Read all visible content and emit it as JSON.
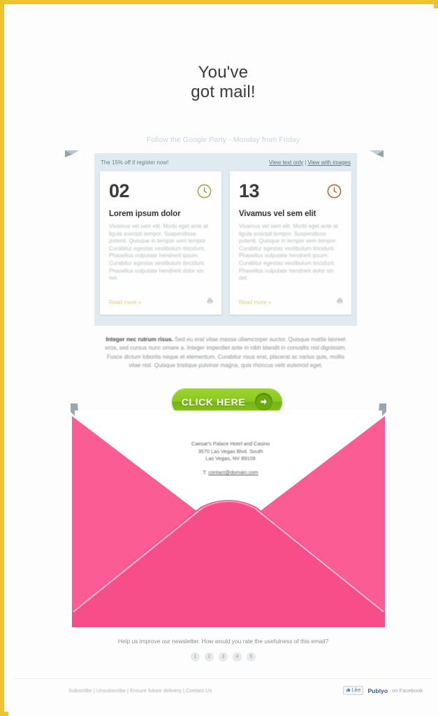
{
  "frame": {
    "border_color": "#efc32b",
    "background": "#fdfdfd"
  },
  "header": {
    "title_line1": "You've",
    "title_line2": "got mail!",
    "preheader": "Follow the Google Party - Monday from Friday"
  },
  "panel": {
    "background": "#dfeaf1",
    "promo_text": "The 15% off if register now!",
    "view_text_only": "View text only",
    "separator": "|",
    "view_with_images": "View with images"
  },
  "cards": [
    {
      "number": "02",
      "clock_icon": "clock-icon",
      "clock_color": "#a8ad4e",
      "heading": "Lorem ipsum dolor",
      "body": "Vivamus vel sem elit. Morbi eget ante at ligula suscipit tempor. Suspendisse potenti. Quisque in tempor sem tempor. Curabitur egestas vestibulum tincidunt. Phasellus vulputate hendrerit ipsum. Curabitur egestas vestibulum tincidunt. Phasellus vulputate hendrerit dolor sin net.",
      "read_more": "Read more »",
      "print_icon": "printer-icon"
    },
    {
      "number": "13",
      "clock_icon": "clock-icon",
      "clock_color": "#b5713f",
      "heading": "Vivamus vel sem elit",
      "body": "Vivamus vel sem elit. Morbi eget ante at ligula suscipit tempor. Suspendisse potenti. Quisque in tempor sem tempor. Curabitur egestas vestibulum tincidunt. Phasellus vulputate hendrerit ipsum. Curabitur egestas vestibulum tincidunt. Phasellus vulputate hendrerit dolor sin det.",
      "read_more": "Read more »",
      "print_icon": "printer-icon"
    }
  ],
  "lead": {
    "bold_intro": "Integer nec rutrum risus.",
    "text": " Sed eu erat vitae massa ullamcorper auctor. Quisque mattis laoreet eros, sed cursus nunc ornare a. Integer imperdiet ante in nibh blandit in convallis nisl dignissim. Fusce dictum lobortis neque et elementum. Curabitur risus erat, placerat ac varius quis, mollis vitae nisl. Quisque tristique pulvinar magna, quis rhoncus velit euismod eget."
  },
  "cta": {
    "label": "CLICK HERE",
    "arrow_icon": "arrow-right-icon",
    "color": "#8ac820"
  },
  "envelope": {
    "body_color": "#f74d89",
    "flap_color": "#fb5c93",
    "card_color": "#ffffff",
    "corner_color": "#9aa7b0",
    "address_line1": "Caesar's Palace Hotel and Casino",
    "address_line2": "3570 Las Vegas Blvd. South",
    "address_line3": "Las Vegas, NV 89109",
    "email_prefix": "T: ",
    "email": "contact@domain.com"
  },
  "rating": {
    "question": "Help us improve our newsletter. How would you rate the usefulness of this email?",
    "options": [
      "1",
      "2",
      "3",
      "4",
      "5"
    ]
  },
  "footer": {
    "links": [
      "Subscribe",
      "Unsubscribe",
      "Ensure future delivery",
      "Contact Us"
    ],
    "separator": "|",
    "like_icon": "thumbs-up-icon",
    "like_label": "Like",
    "brand": "Publyo",
    "brand_tail": "on Facebook"
  }
}
